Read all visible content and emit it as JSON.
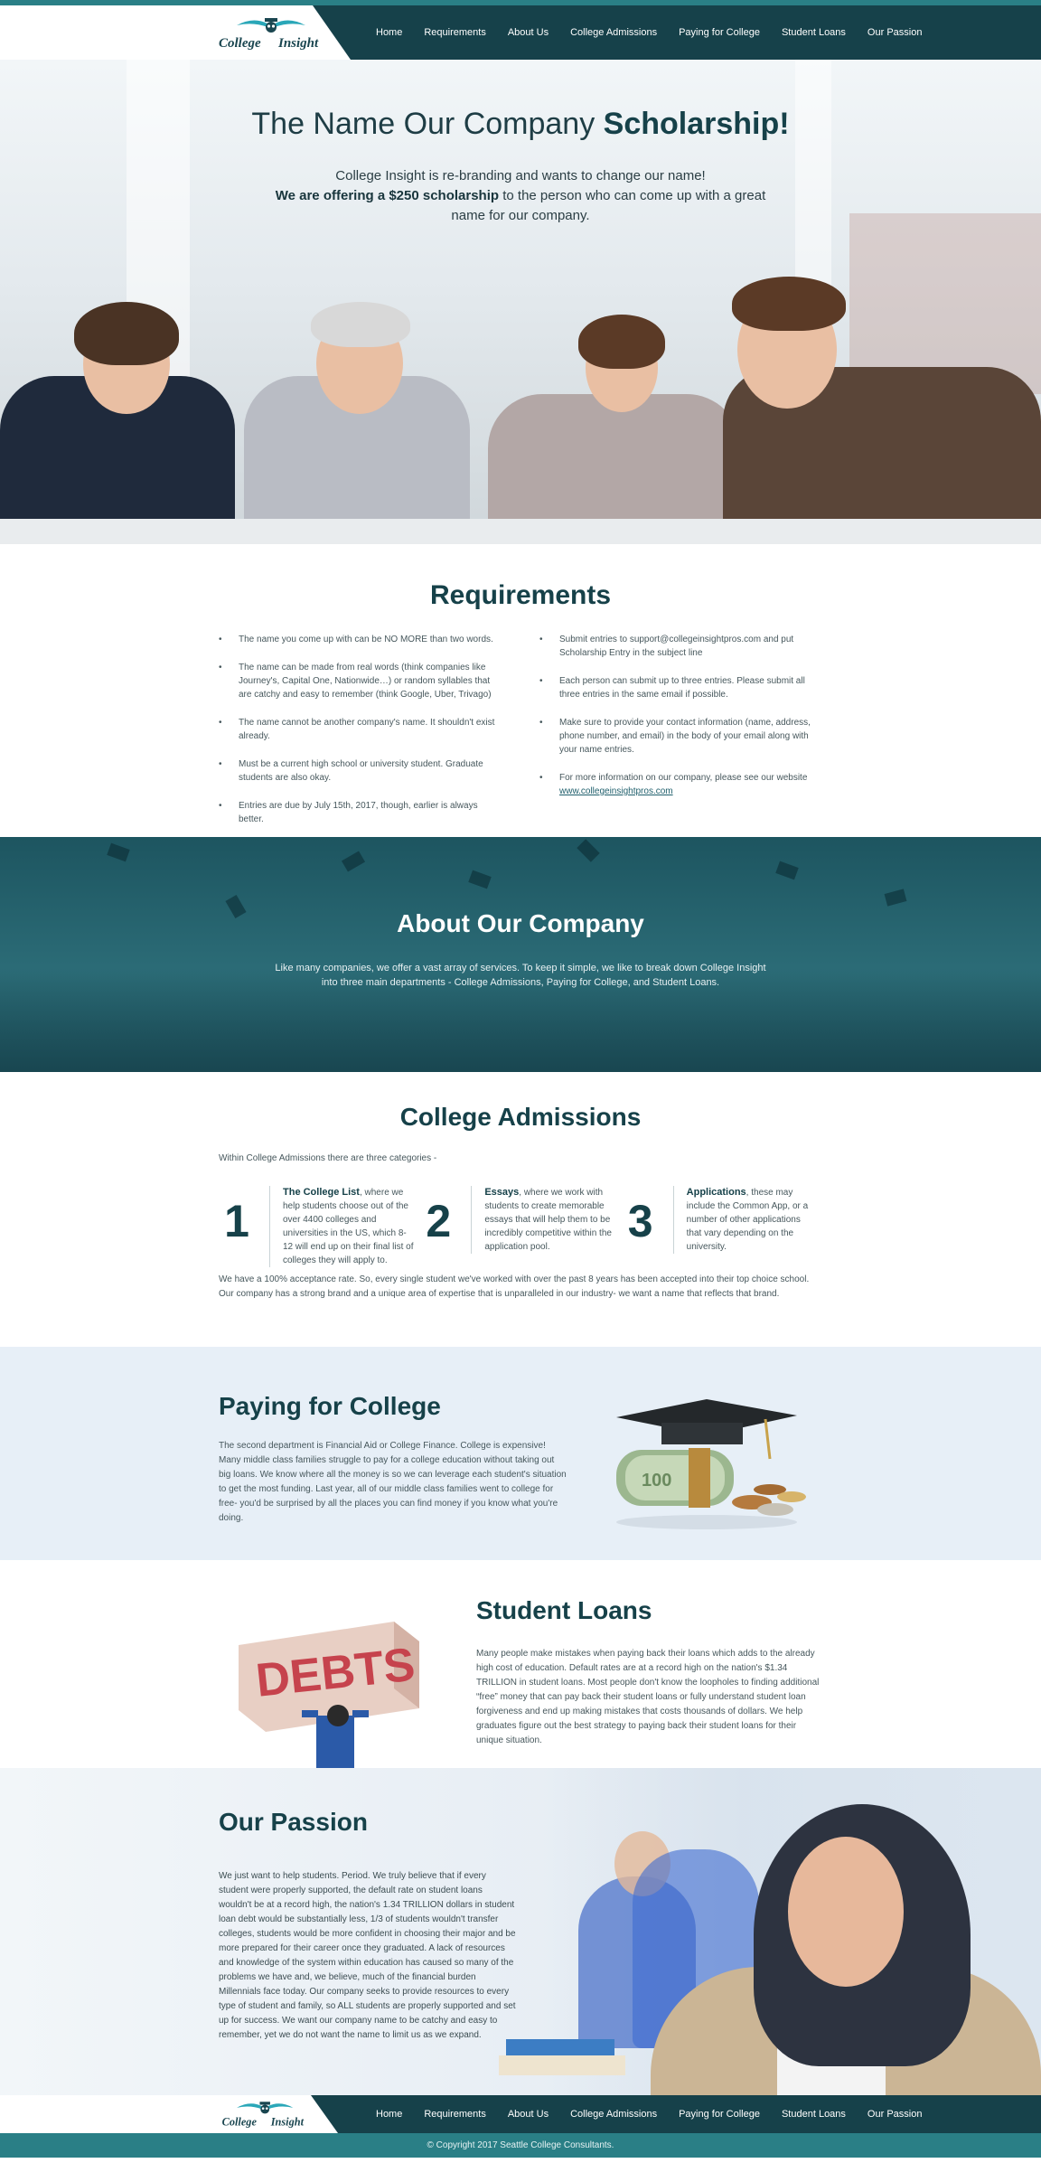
{
  "brand": {
    "logo_word1": "College",
    "logo_word2": "Insight"
  },
  "nav": {
    "items": [
      "Home",
      "Requirements",
      "About Us",
      "College Admissions",
      "Paying for College",
      "Student Loans",
      "Our Passion"
    ]
  },
  "hero": {
    "title_regular": "The Name Our Company",
    "title_bold": "Scholarship!",
    "line1": "College Insight is re-branding and wants to change our name!",
    "line2_bold": "We are offering a $250 scholarship",
    "line2_rest": " to the person who can come up with a great name for our company."
  },
  "requirements": {
    "title": "Requirements",
    "left": [
      "The name you come up with can be NO MORE than two words.",
      "The name can be made from real words (think companies like Journey's, Capital One, Nationwide…) or random syllables that are catchy and easy to remember (think Google, Uber, Trivago)",
      "The name cannot be another company's name. It shouldn't exist already.",
      "Must be a current high school or university student. Graduate students are also okay.",
      "Entries are due by July 15th, 2017, though, earlier is always better."
    ],
    "right": [
      "Submit entries to support@collegeinsightpros.com and put Scholarship Entry in the subject line",
      "Each person can submit up to three entries. Please submit all three entries in the same email if possible.",
      "Make sure to provide your contact information (name, address, phone number, and email) in the body of your email along with your name entries."
    ],
    "right_last_text": "For more information on our company, please see our website",
    "right_last_link": "www.collegeinsightpros.com"
  },
  "about": {
    "title": "About Our Company",
    "text": "Like many companies, we offer a vast array of services. To keep it simple, we like to break down College Insight into three main departments - College Admissions, Paying for College, and Student Loans."
  },
  "admissions": {
    "title": "College Admissions",
    "intro": "Within College Admissions there are three categories -",
    "items": [
      {
        "num": "1",
        "head": "The College List",
        "text": ", where we help students choose out of the over 4400 colleges and universities in the US, which 8-12 will end up on their final list of colleges they will apply to."
      },
      {
        "num": "2",
        "head": "Essays",
        "text": ", where we work with students to create memorable essays that will help them to be incredibly competitive within the application pool."
      },
      {
        "num": "3",
        "head": "Applications",
        "text": ", these may include the Common App, or a number of other applications that vary depending on the university."
      }
    ],
    "outro": "We have a 100% acceptance rate. So, every single student we've worked with over the past 8 years has been accepted into their top choice school. Our company has a strong brand and a unique area of expertise that is unparalleled in our industry- we want a name that reflects that brand."
  },
  "paying": {
    "title": "Paying for College",
    "text": "The second department is Financial Aid or College Finance. College is expensive! Many middle class families struggle to pay for a college education without taking out big loans. We know where all the money is so we can leverage each student's situation to get the most funding. Last year, all of our middle class families went to college for free- you'd be surprised by all the places you can find money if you know what you're doing."
  },
  "loans": {
    "title": "Student Loans",
    "text": "Many people make mistakes when paying back their loans which adds to the already high cost of education. Default rates are at a record high on the nation's $1.34 TRILLION in student loans.  Most people don't know the loopholes to finding additional “free” money that can pay back their student loans or fully understand student loan forgiveness and end up making mistakes that costs thousands of dollars. We help graduates figure out the best strategy to paying back their student loans for their unique situation.",
    "debts_word": "DEBTS"
  },
  "passion": {
    "title": "Our Passion",
    "text": "We just want to help students. Period. We truly believe that if every student were properly supported, the default rate on student loans wouldn't be at a record high, the nation's 1.34 TRILLION dollars in student loan debt would be substantially less, 1/3 of students wouldn't transfer colleges, students would be more confident in choosing their major and be more prepared for their career once they graduated. A lack of resources and knowledge of the system within education has caused so many of the problems we have and, we believe, much of the financial burden Millennials face today. Our company seeks to provide resources to every type of student and family, so ALL students are properly supported and set up for success. We want our company name to be catchy and easy to remember, yet we do not want the name to limit us as we expand."
  },
  "footer": {
    "copyright": "© Copyright 2017 Seattle College Consultants."
  },
  "colors": {
    "primary_dark": "#16414a",
    "teal": "#2a7f86",
    "light_blue_bg": "#e7eff7"
  }
}
